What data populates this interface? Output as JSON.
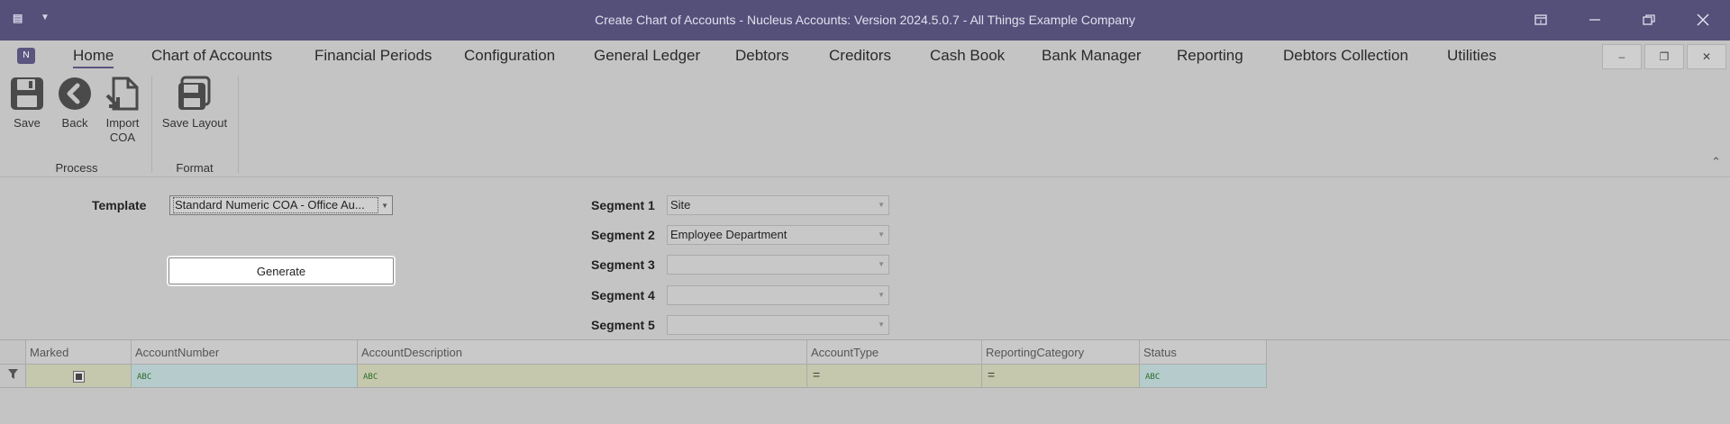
{
  "window": {
    "title": "Create Chart of Accounts - Nucleus Accounts: Version 2024.5.0.7 - All Things Example Company"
  },
  "menu": {
    "items": [
      "Home",
      "Chart of Accounts",
      "Financial Periods",
      "Configuration",
      "General Ledger",
      "Debtors",
      "Creditors",
      "Cash Book",
      "Bank Manager",
      "Reporting",
      "Debtors Collection",
      "Utilities"
    ]
  },
  "ribbon": {
    "save": "Save",
    "back": "Back",
    "import_line1": "Import",
    "import_line2": "COA",
    "save_layout": "Save Layout",
    "group_process": "Process",
    "group_format": "Format"
  },
  "form": {
    "template_label": "Template",
    "template_value": "Standard Numeric COA - Office Au...",
    "generate": "Generate",
    "segments": [
      {
        "label": "Segment 1",
        "value": "Site"
      },
      {
        "label": "Segment 2",
        "value": "Employee Department"
      },
      {
        "label": "Segment 3",
        "value": ""
      },
      {
        "label": "Segment 4",
        "value": ""
      },
      {
        "label": "Segment 5",
        "value": ""
      }
    ]
  },
  "grid": {
    "columns": [
      "Marked",
      "AccountNumber",
      "AccountDescription",
      "AccountType",
      "ReportingCategory",
      "Status"
    ],
    "filter_text_glyph": "ABC",
    "filter_equals_glyph": "="
  },
  "colors": {
    "titlebar": "#54507a",
    "background": "#c4c4c4",
    "filter_text_cell": "#b6cccc",
    "filter_other_cell": "#c5c8ad"
  }
}
